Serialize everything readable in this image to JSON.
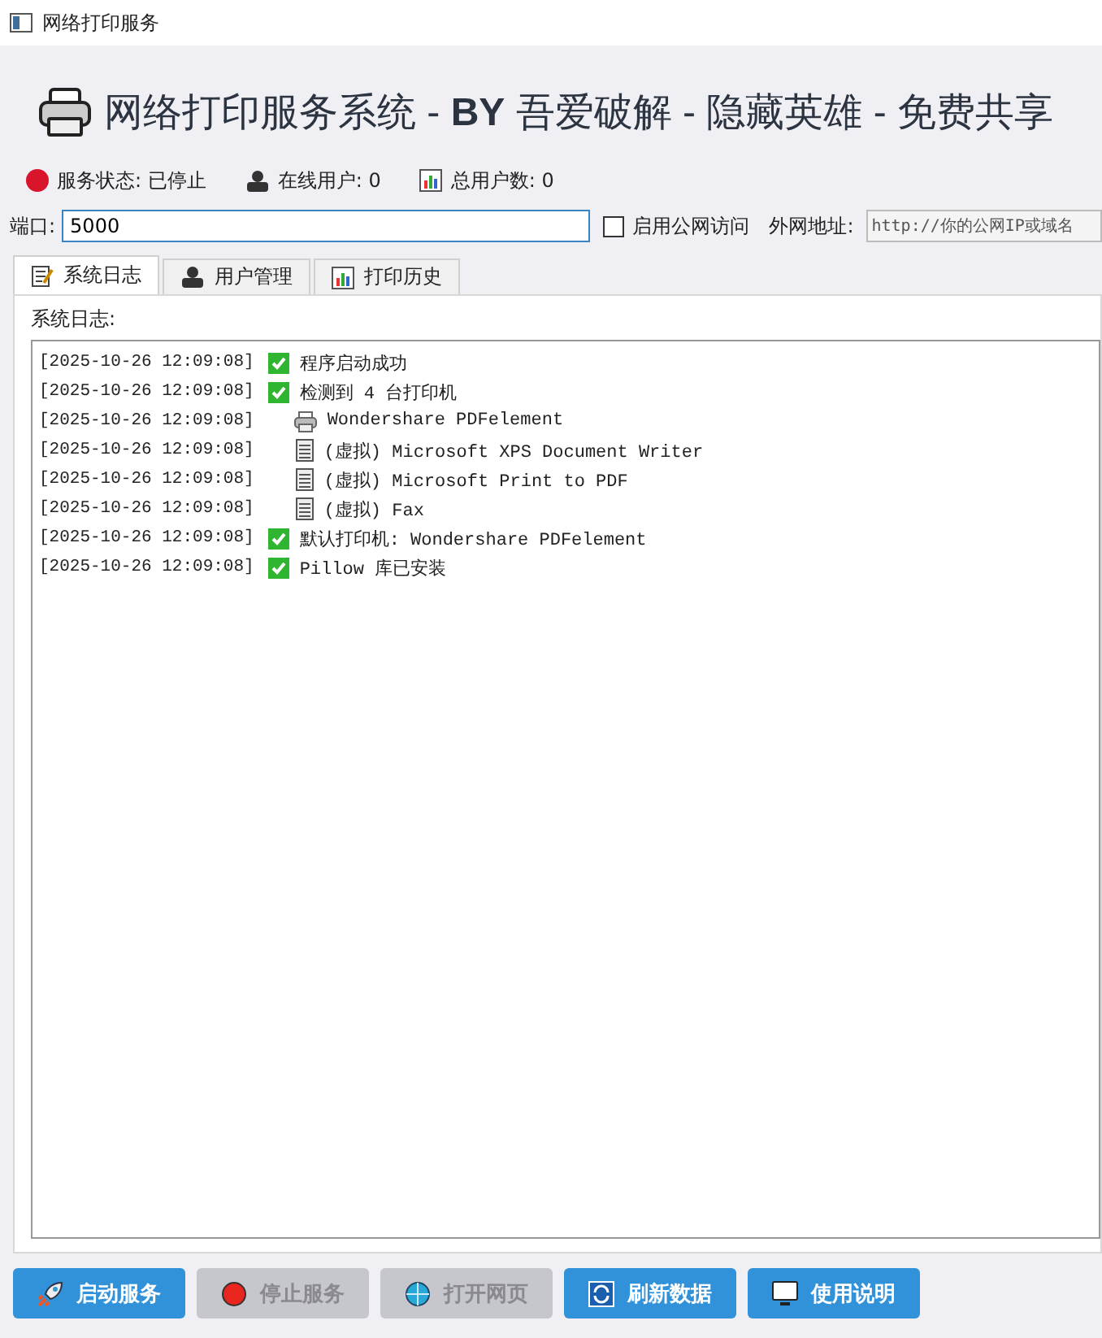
{
  "window": {
    "title": "网络打印服务"
  },
  "header": {
    "title": "网络打印服务系统 - **BY** 吾爱破解 - 隐藏英雄 - 免费共享"
  },
  "status_bar": [
    {
      "kind": "dot",
      "color": "#d9152b",
      "label": "服务状态: 已停止"
    },
    {
      "kind": "users",
      "label": "在线用户: 0"
    },
    {
      "kind": "chart",
      "label": "总用户数: 0"
    }
  ],
  "settings": {
    "port_label": "端口:",
    "port": "5000",
    "public_access": {
      "label": "启用公网访问",
      "checked": false
    },
    "address_label": "外网地址:",
    "address_placeholder": "http://你的公网IP或域名"
  },
  "tabs": [
    {
      "label": "系统日志",
      "kind": "note",
      "selected": true
    },
    {
      "label": "用户管理",
      "kind": "users",
      "selected": false
    },
    {
      "label": "打印历史",
      "kind": "chart",
      "selected": false
    }
  ],
  "log": {
    "label": "系统日志:",
    "lines": [
      {
        "time": "[2025-10-26 12:09:08]",
        "kind": "check",
        "text": "程序启动成功"
      },
      {
        "time": "[2025-10-26 12:09:08]",
        "kind": "check",
        "text": "检测到 4 台打印机"
      },
      {
        "time": "[2025-10-26 12:09:08]",
        "kind": "printer",
        "text": "Wondershare PDFelement"
      },
      {
        "time": "[2025-10-26 12:09:08]",
        "kind": "document",
        "text": "(虚拟) Microsoft XPS Document Writer"
      },
      {
        "time": "[2025-10-26 12:09:08]",
        "kind": "document",
        "text": "(虚拟) Microsoft Print to PDF"
      },
      {
        "time": "[2025-10-26 12:09:08]",
        "kind": "document",
        "text": "(虚拟) Fax"
      },
      {
        "time": "[2025-10-26 12:09:08]",
        "kind": "check",
        "text": "默认打印机: Wondershare PDFelement"
      },
      {
        "time": "[2025-10-26 12:09:08]",
        "kind": "check",
        "text": "Pillow 库已安装"
      }
    ]
  },
  "buttons": [
    {
      "label": "启动服务",
      "kind": "rocket",
      "disabled": false
    },
    {
      "label": "停止服务",
      "kind": "stop",
      "disabled": true
    },
    {
      "label": "打开网页",
      "kind": "globe",
      "disabled": true
    },
    {
      "label": "刷新数据",
      "kind": "refresh",
      "disabled": false
    },
    {
      "label": "使用说明",
      "kind": "screen",
      "disabled": false
    }
  ]
}
